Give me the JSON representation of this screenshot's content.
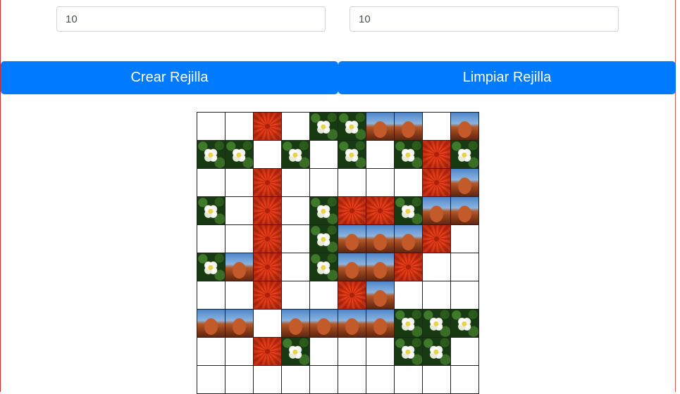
{
  "form": {
    "rows_value": "10",
    "cols_value": "10"
  },
  "buttons": {
    "create_label": "Crear Rejilla",
    "clear_label": "Limpiar Rejilla"
  },
  "image_types": {
    "f": "white-flower-image",
    "d": "red-dahlia-image",
    "r": "desert-rock-image",
    "e": "empty"
  },
  "grid": [
    [
      "e",
      "e",
      "d",
      "e",
      "f",
      "f",
      "r",
      "r",
      "e",
      "r"
    ],
    [
      "f",
      "f",
      "e",
      "f",
      "e",
      "f",
      "e",
      "f",
      "d",
      "f"
    ],
    [
      "e",
      "e",
      "d",
      "e",
      "e",
      "e",
      "e",
      "e",
      "d",
      "r"
    ],
    [
      "f",
      "e",
      "d",
      "e",
      "f",
      "d",
      "d",
      "f",
      "r",
      "r"
    ],
    [
      "e",
      "e",
      "d",
      "e",
      "f",
      "r",
      "r",
      "r",
      "d",
      "e"
    ],
    [
      "f",
      "r",
      "d",
      "e",
      "f",
      "r",
      "r",
      "d",
      "e",
      "e"
    ],
    [
      "e",
      "e",
      "d",
      "e",
      "e",
      "d",
      "r",
      "e",
      "e",
      "e"
    ],
    [
      "r",
      "r",
      "e",
      "r",
      "r",
      "r",
      "r",
      "f",
      "f",
      "f"
    ],
    [
      "e",
      "e",
      "d",
      "f",
      "e",
      "e",
      "e",
      "f",
      "f",
      "e"
    ],
    [
      "e",
      "e",
      "e",
      "e",
      "e",
      "e",
      "e",
      "e",
      "e",
      "e"
    ]
  ]
}
